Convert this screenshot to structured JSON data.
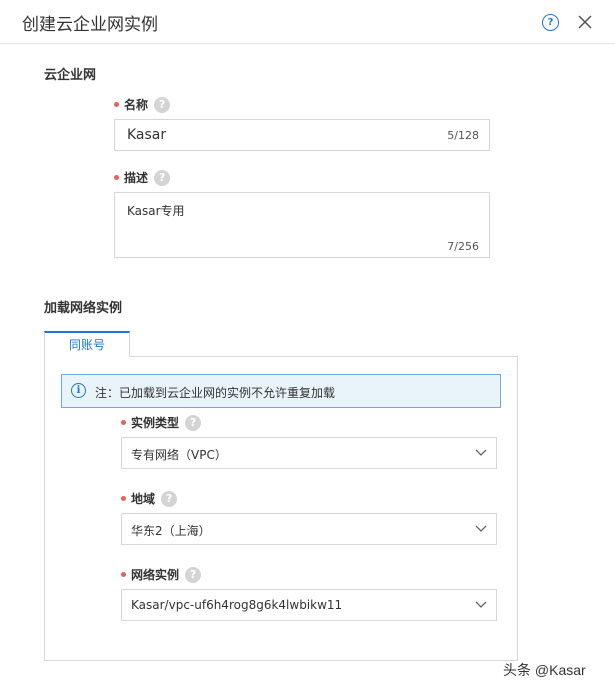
{
  "dialog": {
    "title": "创建云企业网实例",
    "help_icon": "?",
    "close_icon": "close-icon"
  },
  "cen_section": {
    "title": "云企业网",
    "name_label": "名称",
    "name_value": "Kasar",
    "name_counter": "5/128",
    "desc_label": "描述",
    "desc_value": "Kasar专用",
    "desc_counter": "7/256"
  },
  "attach_section": {
    "title": "加载网络实例",
    "tab_label": "同账号",
    "notice_icon": "i",
    "notice_text": "注：已加载到云企业网的实例不允许重复加载",
    "instance_type_label": "实例类型",
    "instance_type_value": "专有网络（VPC）",
    "region_label": "地域",
    "region_value": "华东2（上海）",
    "network_label": "网络实例",
    "network_value": "Kasar/vpc-uf6h4rog8g6k4lwbikw11"
  },
  "help_glyph": "?",
  "watermark": "头条 @Kasar",
  "colors": {
    "accent": "#1f74d2",
    "required": "#e9605b",
    "notice_bg": "#e9f3fa",
    "notice_border": "#66aede"
  }
}
